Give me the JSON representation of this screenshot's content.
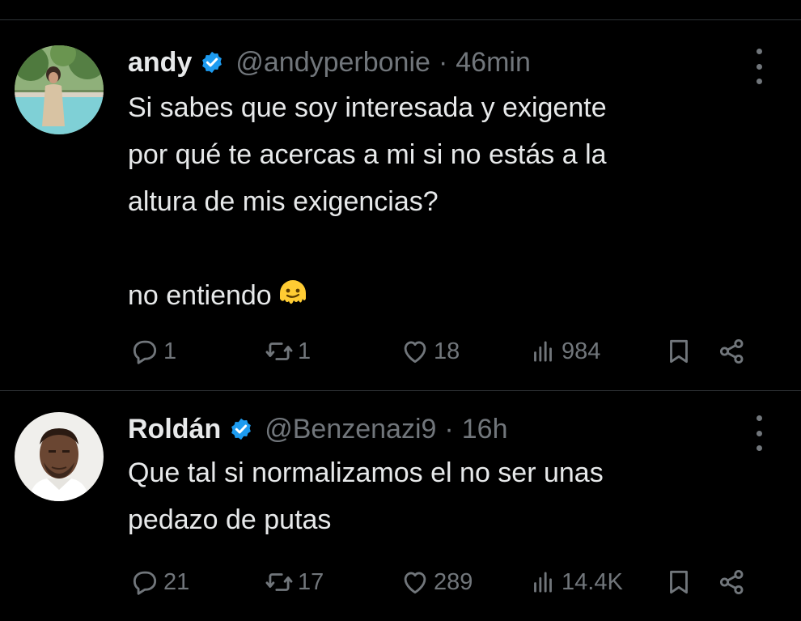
{
  "tweets": [
    {
      "name": "andy",
      "handle": "@andyperbonie",
      "separator": "·",
      "time": "46min",
      "lines": [
        "Si sabes que soy interesada y exigente",
        "por qué te acercas a mi si no estás a la",
        "altura de mis exigencias?"
      ],
      "final_line": "no entiendo",
      "emoji_icon": "melting-face-icon",
      "replies": "1",
      "retweets": "1",
      "likes": "18",
      "views": "984"
    },
    {
      "name": "Roldán",
      "handle": "@Benzenazi9",
      "separator": "·",
      "time": "16h",
      "lines": [
        "Que tal si normalizamos el no ser unas",
        "pedazo de putas"
      ],
      "replies": "21",
      "retweets": "17",
      "likes": "289",
      "views": "14.4K"
    }
  ],
  "colors": {
    "background": "#000000",
    "text": "#e7e9ea",
    "muted": "#71767b",
    "verified": "#1d9bf0",
    "divider": "#2f3336"
  },
  "icons": {
    "verified": "verified-badge-icon",
    "more": "more-options-icon",
    "reply": "reply-icon",
    "retweet": "retweet-icon",
    "like": "heart-icon",
    "views": "views-chart-icon",
    "bookmark": "bookmark-icon",
    "share": "share-icon"
  }
}
